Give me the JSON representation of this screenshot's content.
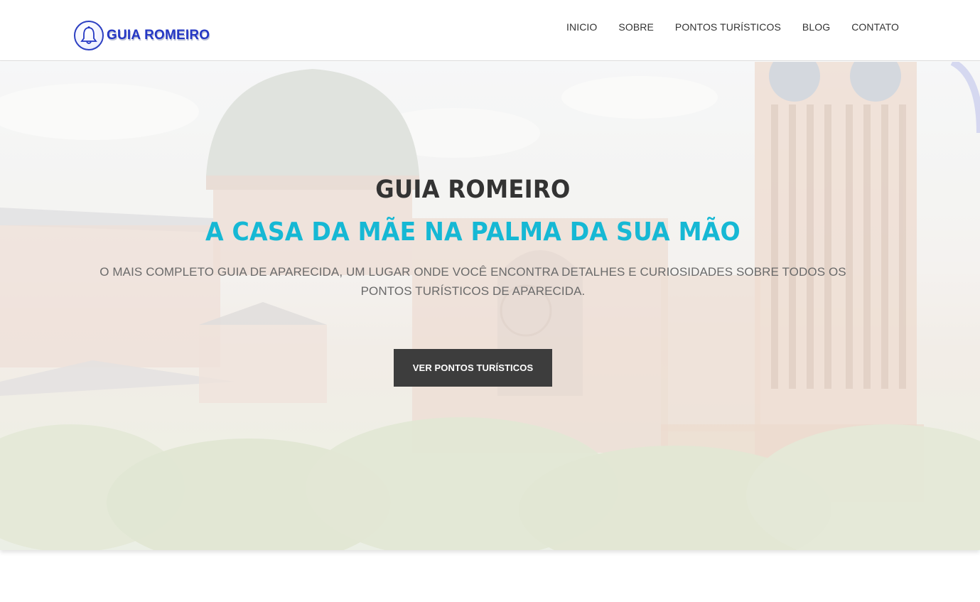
{
  "header": {
    "logo_text": "GUIA ROMEIRO",
    "logo_icon": "bell-icon",
    "nav": [
      {
        "label": "INICIO"
      },
      {
        "label": "SOBRE"
      },
      {
        "label": "PONTOS TURÍSTICOS"
      },
      {
        "label": "BLOG"
      },
      {
        "label": "CONTATO"
      }
    ]
  },
  "hero": {
    "title": "GUIA ROMEIRO",
    "subtitle": "A CASA DA MÃE NA PALMA DA SUA MÃO",
    "description": "O MAIS COMPLETO GUIA DE APARECIDA, UM LUGAR ONDE VOCÊ ENCONTRA DETALHES E CURIOSIDADES SOBRE TODOS OS PONTOS TURÍSTICOS DE APARECIDA.",
    "button_label": "VER PONTOS TURÍSTICOS",
    "background_image": "basilica-photo"
  },
  "colors": {
    "accent": "#16b8d4",
    "logo": "#2437c4",
    "button_bg": "#3d3d3d",
    "text_dark": "#333333"
  }
}
